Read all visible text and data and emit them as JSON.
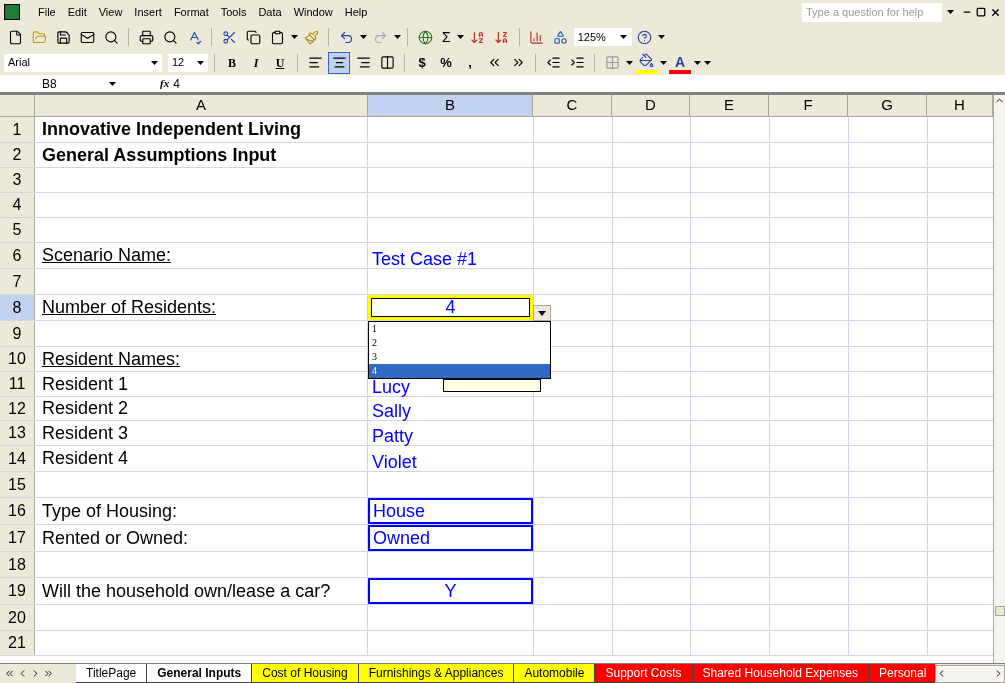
{
  "menu_bar": {
    "items": [
      "File",
      "Edit",
      "View",
      "Insert",
      "Format",
      "Tools",
      "Data",
      "Window",
      "Help"
    ],
    "help_placeholder": "Type a question for help"
  },
  "standard_toolbar": {
    "sum_label": "Σ",
    "zoom": "125%"
  },
  "formatting_toolbar": {
    "font": "Arial",
    "size": "12",
    "style_buttons": [
      {
        "label": "B",
        "kind": "bold"
      },
      {
        "label": "I",
        "kind": "italic"
      },
      {
        "label": "U",
        "kind": "underline"
      }
    ],
    "align_buttons": [
      {
        "selected": false
      },
      {
        "selected": true
      },
      {
        "selected": false
      }
    ],
    "number_buttons": [
      "$",
      "%",
      ","
    ],
    "font_color_label": "A"
  },
  "formula_bar": {
    "name_box": "B8",
    "fx_label": "fx",
    "formula": "4"
  },
  "columns": [
    {
      "label": "A",
      "selected": false
    },
    {
      "label": "B",
      "selected": true
    },
    {
      "label": "C",
      "selected": false
    },
    {
      "label": "D",
      "selected": false
    },
    {
      "label": "E",
      "selected": false
    },
    {
      "label": "F",
      "selected": false
    },
    {
      "label": "G",
      "selected": false
    },
    {
      "label": "H",
      "selected": false
    }
  ],
  "rows": [
    {
      "number": "1",
      "selected": false,
      "a": {
        "text": "Innovative Independent Living",
        "bold": true,
        "underline": false
      }
    },
    {
      "number": "2",
      "selected": false,
      "a": {
        "text": "General Assumptions Input",
        "bold": true,
        "underline": false
      }
    },
    {
      "number": "3",
      "selected": false
    },
    {
      "number": "4",
      "selected": false
    },
    {
      "number": "5",
      "selected": false
    },
    {
      "number": "6",
      "selected": false,
      "a": {
        "text": "Scenario Name:",
        "bold": false,
        "underline": true
      },
      "b": {
        "text": "Test Case #1",
        "kind": "plain"
      }
    },
    {
      "number": "7",
      "selected": false
    },
    {
      "number": "8",
      "selected": true,
      "a": {
        "text": "Number of Residents:",
        "bold": false,
        "underline": true
      },
      "b": {
        "text": "4",
        "kind": "active"
      }
    },
    {
      "number": "9",
      "selected": false
    },
    {
      "number": "10",
      "selected": false,
      "a": {
        "text": "Resident Names:",
        "bold": false,
        "underline": true
      }
    },
    {
      "number": "11",
      "selected": false,
      "a": {
        "text": "Resident 1",
        "bold": false,
        "underline": false
      },
      "b": {
        "text": "Lucy",
        "kind": "plain"
      }
    },
    {
      "number": "12",
      "selected": false,
      "a": {
        "text": "Resident 2",
        "bold": false,
        "underline": false
      },
      "b": {
        "text": "Sally",
        "kind": "plain"
      }
    },
    {
      "number": "13",
      "selected": false,
      "a": {
        "text": "Resident 3",
        "bold": false,
        "underline": false
      },
      "b": {
        "text": "Patty",
        "kind": "plain"
      }
    },
    {
      "number": "14",
      "selected": false,
      "a": {
        "text": "Resident 4",
        "bold": false,
        "underline": false
      },
      "b": {
        "text": "Violet",
        "kind": "plain"
      }
    },
    {
      "number": "15",
      "selected": false
    },
    {
      "number": "16",
      "selected": false,
      "a": {
        "text": "Type of Housing:",
        "bold": false,
        "underline": false
      },
      "b": {
        "text": "House",
        "kind": "boxed"
      }
    },
    {
      "number": "17",
      "selected": false,
      "a": {
        "text": "Rented or Owned:",
        "bold": false,
        "underline": false
      },
      "b": {
        "text": "Owned",
        "kind": "boxed"
      }
    },
    {
      "number": "18",
      "selected": false
    },
    {
      "number": "19",
      "selected": false,
      "a": {
        "text": "Will the household own/lease a car?",
        "bold": false,
        "underline": false
      },
      "b": {
        "text": "Y",
        "kind": "boxed_center"
      }
    },
    {
      "number": "20",
      "selected": false
    },
    {
      "number": "21",
      "selected": false
    }
  ],
  "dropdown": {
    "options": [
      {
        "label": "1",
        "selected": false
      },
      {
        "label": "2",
        "selected": false
      },
      {
        "label": "3",
        "selected": false
      },
      {
        "label": "4",
        "selected": true
      }
    ]
  },
  "sheet_tabs": [
    {
      "label": "TitlePage",
      "selected": false,
      "color": "#ffffff"
    },
    {
      "label": "General Inputs",
      "selected": true,
      "color": "#ffffff"
    },
    {
      "label": "Cost of Housing",
      "selected": false,
      "color": "#ffff00"
    },
    {
      "label": "Furnishings & Appliances",
      "selected": false,
      "color": "#ffff00"
    },
    {
      "label": "Automobile",
      "selected": false,
      "color": "#ffff00"
    },
    {
      "label": "Support Costs",
      "selected": false,
      "color": "#ff0000"
    },
    {
      "label": "Shared Household Expenses",
      "selected": false,
      "color": "#ff0000"
    },
    {
      "label": "Personal",
      "selected": false,
      "color": "#ff0000"
    }
  ]
}
